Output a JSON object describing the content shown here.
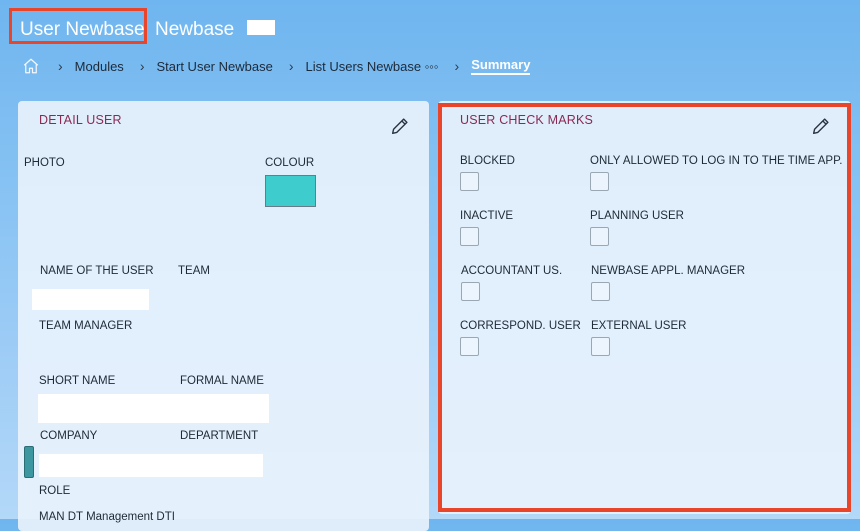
{
  "header": {
    "title": "User Newbase",
    "subtitle": "Newbase"
  },
  "breadcrumb": {
    "home_icon": "home-icon",
    "items": [
      "Modules",
      "Start User Newbase",
      "List Users Newbase ◦◦◦",
      "Summary"
    ],
    "separator": "›"
  },
  "detail_user": {
    "title": "DETAIL USER",
    "edit_icon": "pencil-icon",
    "photo_label": "PHOTO",
    "colour_label": "COLOUR",
    "colour_value": "#3ecdcc",
    "name_label": "NAME OF THE USER",
    "team_label": "TEAM",
    "team_manager_label": "TEAM MANAGER",
    "short_name_label": "SHORT NAME",
    "formal_name_label": "FORMAL NAME",
    "company_label": "COMPANY",
    "department_label": "DEPARTMENT",
    "role_label": "ROLE",
    "role_value": "MAN DT Management DTI"
  },
  "user_check_marks": {
    "title": "USER CHECK MARKS",
    "edit_icon": "pencil-icon",
    "items": [
      {
        "label": "BLOCKED",
        "checked": false
      },
      {
        "label": "ONLY ALLOWED TO LOG IN TO THE TIME APP.",
        "checked": false
      },
      {
        "label": "INACTIVE",
        "checked": false
      },
      {
        "label": "PLANNING USER",
        "checked": false
      },
      {
        "label": "ACCOUNTANT US.",
        "checked": false
      },
      {
        "label": "NEWBASE APPL. MANAGER",
        "checked": false
      },
      {
        "label": "CORRESPOND. USER",
        "checked": false
      },
      {
        "label": "EXTERNAL USER",
        "checked": false
      }
    ]
  },
  "colors": {
    "accent_red": "#e8452a",
    "title_maroon": "#8a2a54",
    "swatch_teal": "#3ecdcc"
  }
}
